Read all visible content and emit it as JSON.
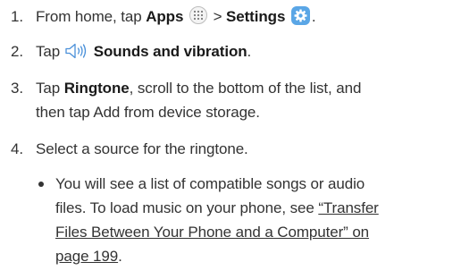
{
  "steps": [
    {
      "number": "1.",
      "part1": "From home, tap ",
      "apps_label": "Apps",
      "separator": " > ",
      "settings_label": "Settings",
      "end": "."
    },
    {
      "number": "2.",
      "part1": "Tap ",
      "sounds_label": "Sounds and vibration",
      "end": "."
    },
    {
      "number": "3.",
      "part1": "Tap ",
      "ringtone_label": "Ringtone",
      "line1_rest": ", scroll to the bottom of the list, and",
      "line2": "then tap Add from device storage."
    },
    {
      "number": "4.",
      "text": "Select a source for the ringtone."
    }
  ],
  "bullet": {
    "line1": "You will see a list of compatible songs or audio",
    "line2_text": "files. To load music on your phone, see ",
    "link_part1": "“Transfer",
    "link_part2": "Files Between Your Phone and a Computer” on",
    "link_part3": "page 199",
    "end": "."
  },
  "icons": {
    "apps": "apps-grid-icon",
    "settings": "settings-gear-icon",
    "sound": "speaker-sound-icon"
  },
  "colors": {
    "text": "#333333",
    "settings_icon_bg": "#5aa6e6"
  }
}
